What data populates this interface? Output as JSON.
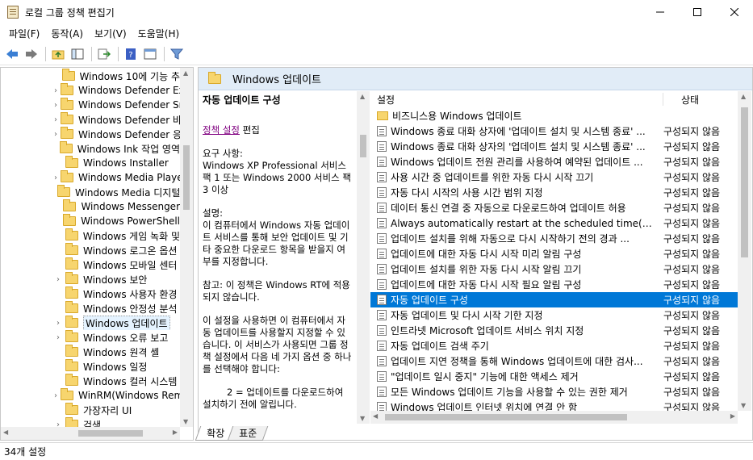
{
  "window": {
    "title": "로컬 그룹 정책 편집기"
  },
  "menu": [
    "파일(F)",
    "동작(A)",
    "보기(V)",
    "도움말(H)"
  ],
  "tree": {
    "items": [
      {
        "label": "Windows 10에 기능 추",
        "expandable": false
      },
      {
        "label": "Windows Defender Ex",
        "expandable": true
      },
      {
        "label": "Windows Defender Sn",
        "expandable": true
      },
      {
        "label": "Windows Defender 바",
        "expandable": true
      },
      {
        "label": "Windows Defender 응",
        "expandable": true
      },
      {
        "label": "Windows Ink 작업 영역",
        "expandable": false
      },
      {
        "label": "Windows Installer",
        "expandable": false
      },
      {
        "label": "Windows Media Player",
        "expandable": true
      },
      {
        "label": "Windows Media 디지털",
        "expandable": false
      },
      {
        "label": "Windows Messenger",
        "expandable": false
      },
      {
        "label": "Windows PowerShell",
        "expandable": false
      },
      {
        "label": "Windows 게임 녹화 및",
        "expandable": false
      },
      {
        "label": "Windows 로그온 옵션",
        "expandable": false
      },
      {
        "label": "Windows 모바일 센터",
        "expandable": false
      },
      {
        "label": "Windows 보안",
        "expandable": true
      },
      {
        "label": "Windows 사용자 환경",
        "expandable": false
      },
      {
        "label": "Windows 안정성 분석",
        "expandable": false
      },
      {
        "label": "Windows 업데이트",
        "expandable": true,
        "selected": true
      },
      {
        "label": "Windows 오류 보고",
        "expandable": true
      },
      {
        "label": "Windows 원격 셸",
        "expandable": false
      },
      {
        "label": "Windows 일정",
        "expandable": false
      },
      {
        "label": "Windows 컬러 시스템",
        "expandable": false
      },
      {
        "label": "WinRM(Windows Rem",
        "expandable": true
      },
      {
        "label": "가장자리 UI",
        "expandable": false
      },
      {
        "label": "검색",
        "expandable": true
      }
    ]
  },
  "pane": {
    "header": "Windows 업데이트",
    "desc": {
      "title": "자동 업데이트 구성",
      "edit_link": "정책 설정",
      "edit_suffix": " 편집",
      "req_label": "요구 사항:",
      "req_text": "Windows XP Professional 서비스 팩 1 또는 Windows 2000 서비스 팩 3 이상",
      "desc_label": "설명:",
      "desc_text": "이 컴퓨터에서 Windows 자동 업데이트 서비스를 통해 보안 업데이트 및 기타 중요한 다운로드 항목을 받을지 여부를 지정합니다.",
      "note": "참고: 이 정책은 Windows RT에 적용되지 않습니다.",
      "more": "이 설정을 사용하면 이 컴퓨터에서 자동 업데이트를 사용할지 지정할 수 있습니다. 이 서비스가 사용되면 그룹 정책 설정에서 다음 네 가지 옵션 중 하나를 선택해야 합니다:",
      "option2": "2 = 업데이트를 다운로드하여 설치하기 전에 알립니다."
    },
    "list": {
      "col_setting": "설정",
      "col_state": "상태",
      "rows": [
        {
          "name": "비즈니스용 Windows 업데이트",
          "state": "",
          "folder": true
        },
        {
          "name": "Windows 종료 대화 상자에 '업데이트 설치 및 시스템 종료' ...",
          "state": "구성되지 않음"
        },
        {
          "name": "Windows 종료 대화 상자의 '업데이트 설치 및 시스템 종료' ...",
          "state": "구성되지 않음"
        },
        {
          "name": "Windows 업데이트 전원 관리를 사용하여 예약된 업데이트 ...",
          "state": "구성되지 않음"
        },
        {
          "name": "사용 시간 중 업데이트를 위한 자동 다시 시작 끄기",
          "state": "구성되지 않음"
        },
        {
          "name": "자동 다시 시작의 사용 시간 범위 지정",
          "state": "구성되지 않음"
        },
        {
          "name": "데이터 통신 연결 중 자동으로 다운로드하여 업데이트 허용",
          "state": "구성되지 않음"
        },
        {
          "name": "Always automatically restart at the scheduled time(항상 예...",
          "state": "구성되지 않음"
        },
        {
          "name": "업데이트 설치를 위해 자동으로 다시 시작하기 전의 경과 ...",
          "state": "구성되지 않음"
        },
        {
          "name": "업데이트에 대한 자동 다시 시작 미리 알림 구성",
          "state": "구성되지 않음"
        },
        {
          "name": "업데이트 설치를 위한 자동 다시 시작 알림 끄기",
          "state": "구성되지 않음"
        },
        {
          "name": "업데이트에 대한 자동 다시 시작 필요 알림 구성",
          "state": "구성되지 않음"
        },
        {
          "name": "자동 업데이트 구성",
          "state": "구성되지 않음",
          "selected": true
        },
        {
          "name": "자동 업데이트 및 다시 시작 기한 지정",
          "state": "구성되지 않음"
        },
        {
          "name": "인트라넷 Microsoft 업데이트 서비스 위치 지정",
          "state": "구성되지 않음"
        },
        {
          "name": "자동 업데이트 검색 주기",
          "state": "구성되지 않음"
        },
        {
          "name": "업데이트 지연 정책을 통해 Windows 업데이트에 대한 검사...",
          "state": "구성되지 않음"
        },
        {
          "name": "\"업데이트 일시 중지\" 기능에 대한 액세스 제거",
          "state": "구성되지 않음"
        },
        {
          "name": "모든 Windows 업데이트 기능을 사용할 수 있는 권한 제거",
          "state": "구성되지 않음"
        },
        {
          "name": "Windows 업데이트 인터넷 위치에 연결 안 함",
          "state": "구성되지 않음"
        }
      ]
    }
  },
  "tabs": [
    "확장",
    "표준"
  ],
  "status": "34개 설정",
  "colors": {
    "selection": "#0078d7",
    "header_bg": "#e1ecf7"
  }
}
